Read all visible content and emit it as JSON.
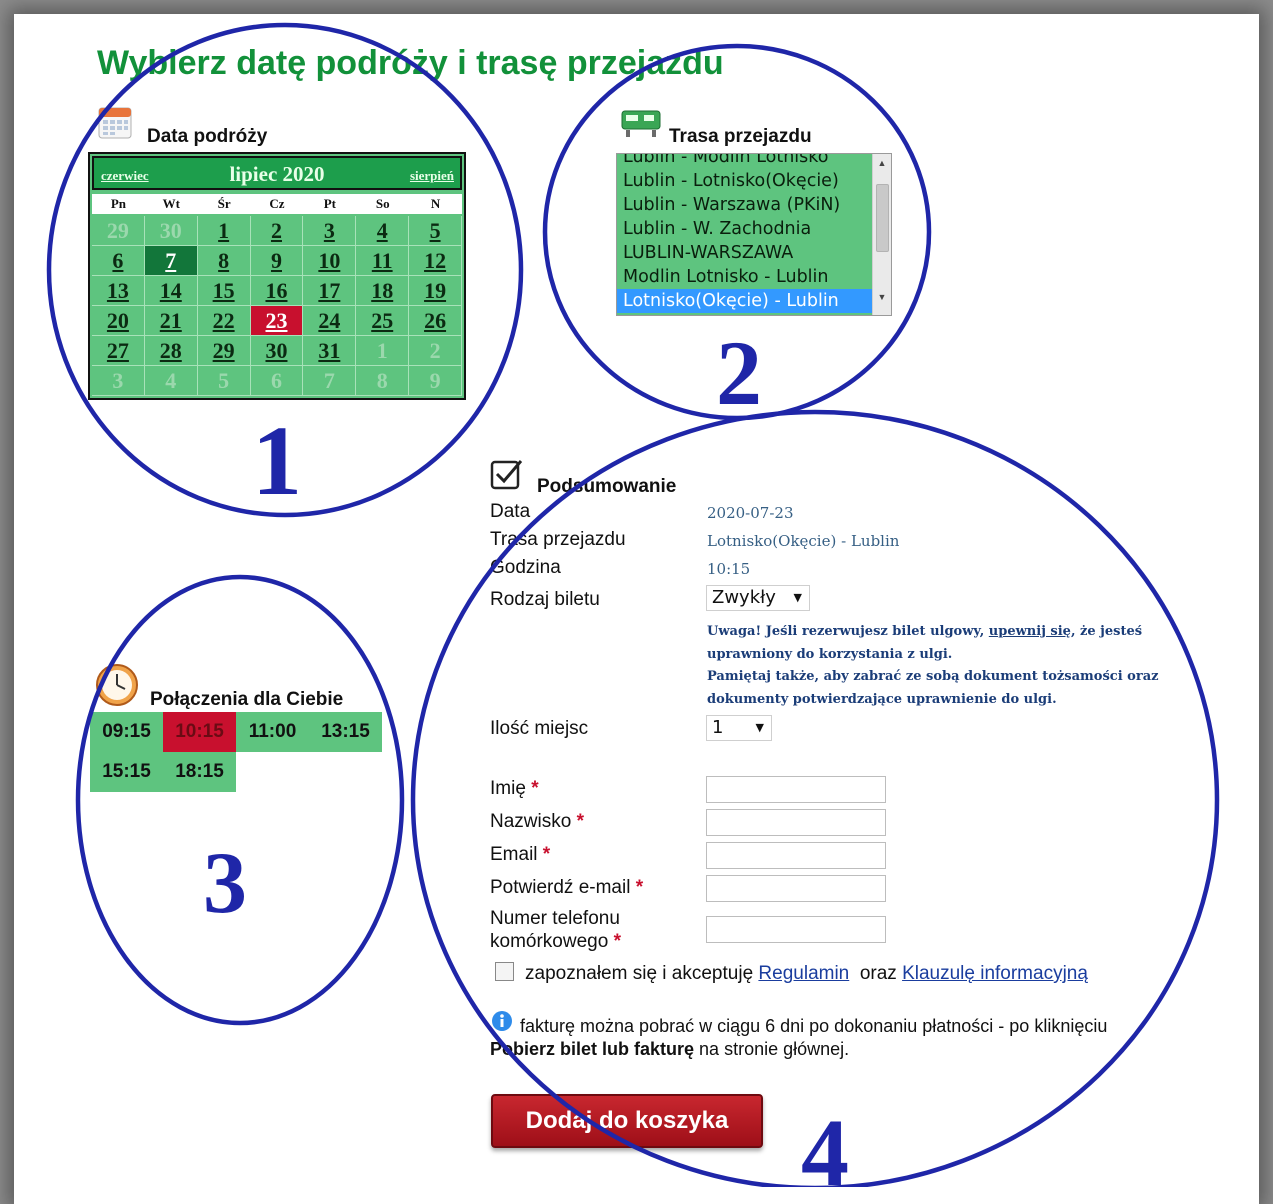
{
  "page_title": "Wybierz datę podróży i trasę przejazdu",
  "calendar": {
    "section_title": "Data podróży",
    "prev_month": "czerwiec",
    "month": "lipiec 2020",
    "next_month": "sierpień",
    "day_headers": [
      "Pn",
      "Wt",
      "Śr",
      "Cz",
      "Pt",
      "So",
      "N"
    ],
    "days": [
      {
        "d": "29",
        "other": true
      },
      {
        "d": "30",
        "other": true
      },
      {
        "d": "1"
      },
      {
        "d": "2"
      },
      {
        "d": "3"
      },
      {
        "d": "4"
      },
      {
        "d": "5"
      },
      {
        "d": "6"
      },
      {
        "d": "7",
        "today": true
      },
      {
        "d": "8"
      },
      {
        "d": "9"
      },
      {
        "d": "10"
      },
      {
        "d": "11"
      },
      {
        "d": "12"
      },
      {
        "d": "13"
      },
      {
        "d": "14"
      },
      {
        "d": "15"
      },
      {
        "d": "16"
      },
      {
        "d": "17"
      },
      {
        "d": "18"
      },
      {
        "d": "19"
      },
      {
        "d": "20"
      },
      {
        "d": "21"
      },
      {
        "d": "22"
      },
      {
        "d": "23",
        "selected": true
      },
      {
        "d": "24"
      },
      {
        "d": "25"
      },
      {
        "d": "26"
      },
      {
        "d": "27"
      },
      {
        "d": "28"
      },
      {
        "d": "29"
      },
      {
        "d": "30"
      },
      {
        "d": "31"
      },
      {
        "d": "1",
        "other": true
      },
      {
        "d": "2",
        "other": true
      },
      {
        "d": "3",
        "other": true
      },
      {
        "d": "4",
        "other": true
      },
      {
        "d": "5",
        "other": true
      },
      {
        "d": "6",
        "other": true
      },
      {
        "d": "7",
        "other": true
      },
      {
        "d": "8",
        "other": true
      },
      {
        "d": "9",
        "other": true
      }
    ]
  },
  "route": {
    "section_title": "Trasa przejazdu",
    "items": [
      "Lublin - Modlin Lotnisko",
      "Lublin - Lotnisko(Okęcie)",
      "Lublin - Warszawa (PKiN)",
      "Lublin - W. Zachodnia",
      "LUBLIN-WARSZAWA",
      "Modlin Lotnisko - Lublin",
      "Lotnisko(Okęcie) - Lublin"
    ],
    "selected_index": 6
  },
  "departures": {
    "section_title": "Połączenia dla Ciebie",
    "times": [
      "09:15",
      "10:15",
      "11:00",
      "13:15",
      "15:15",
      "18:15"
    ],
    "selected_index": 1
  },
  "summary": {
    "section_title": "Podsumowanie",
    "date_label": "Data",
    "date_value": "2020-07-23",
    "route_label": "Trasa przejazdu",
    "route_value": "Lotnisko(Okęcie) - Lublin",
    "time_label": "Godzina",
    "time_value": "10:15",
    "ticket_label": "Rodzaj biletu",
    "ticket_value": "Zwykły",
    "warning_1": "Uwaga! Jeśli rezerwujesz bilet ulgowy,",
    "warning_link": "upewnij się",
    "warning_2": ", że jesteś uprawniony do korzystania z ulgi.",
    "warning_3": "Pamiętaj także, aby zabrać ze sobą dokument tożsamości oraz dokumenty potwierdzające uprawnienie do ulgi.",
    "seats_label": "Ilość miejsc",
    "seats_value": "1",
    "first_name_label": "Imię",
    "last_name_label": "Nazwisko",
    "email_label": "Email",
    "confirm_email_label": "Potwierdź e-mail",
    "phone_label_1": "Numer telefonu",
    "phone_label_2": "komórkowego",
    "required_mark": "*",
    "consent_text": "zapoznałem się i akceptuję",
    "consent_link_1": "Regulamin",
    "consent_and": "oraz",
    "consent_link_2": "Klauzulę informacyjną",
    "invoice_text": "fakturę można pobrać w ciągu 6 dni po dokonaniu płatności - po kliknięciu",
    "invoice_bold": "Pobierz bilet lub fakturę",
    "invoice_tail": "na stronie głównej.",
    "add_button": "Dodaj do koszyka"
  },
  "annotations": [
    "1",
    "2",
    "3",
    "4"
  ]
}
